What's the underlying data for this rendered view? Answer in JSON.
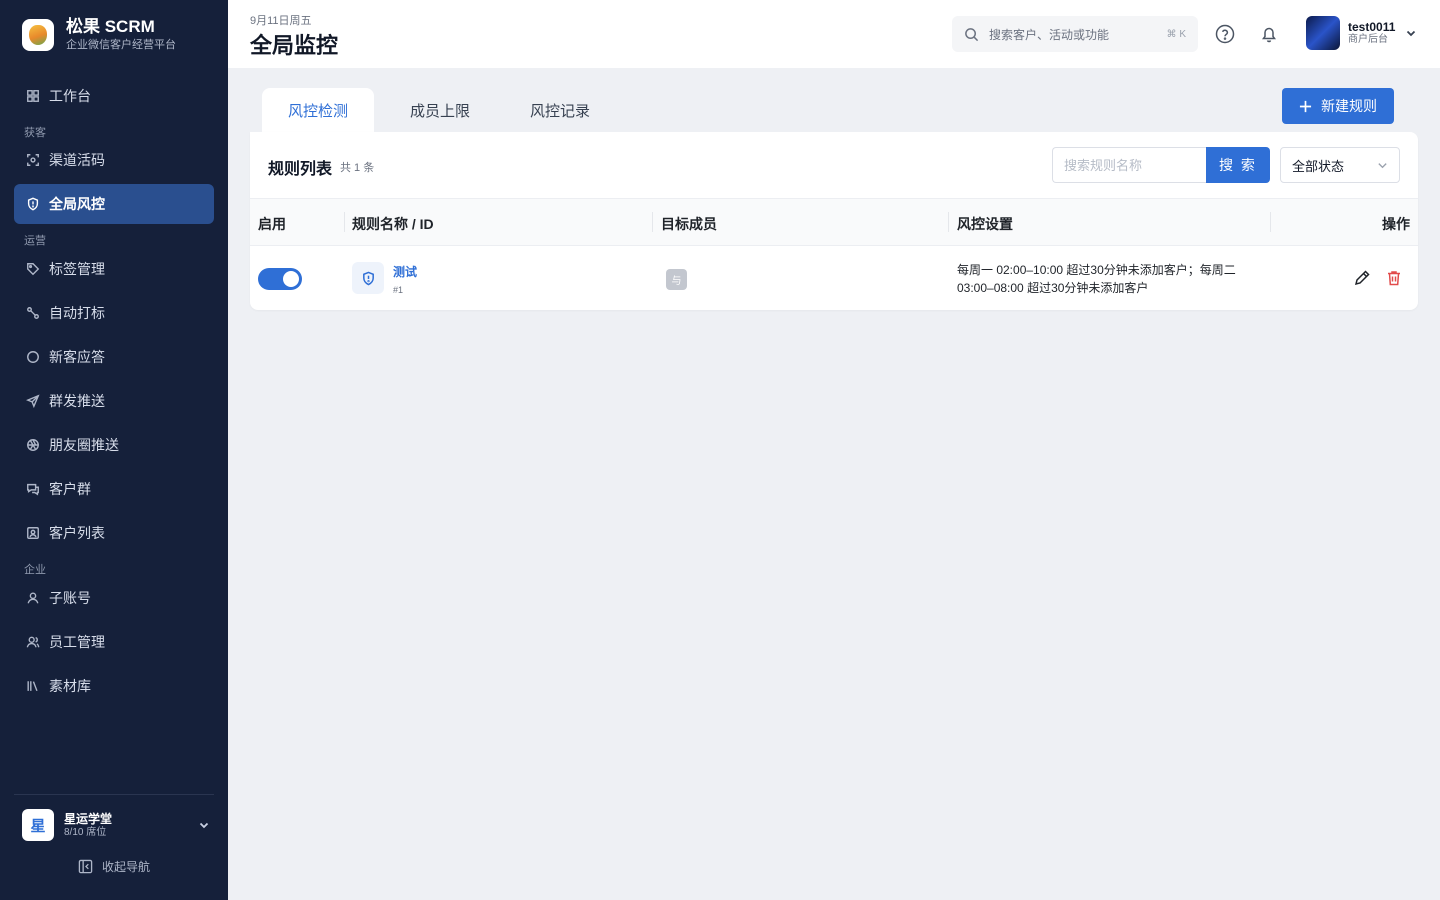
{
  "brand": {
    "name": "松果 SCRM",
    "subtitle": "企业微信客户经营平台"
  },
  "sidebar": {
    "items": [
      {
        "label": "工作台",
        "icon": "grid-icon"
      },
      {
        "group": "获客"
      },
      {
        "label": "渠道活码",
        "icon": "scan-icon"
      },
      {
        "label": "全局风控",
        "icon": "shield-icon",
        "active": true
      },
      {
        "group": "运营"
      },
      {
        "label": "标签管理",
        "icon": "tag-icon"
      },
      {
        "label": "自动打标",
        "icon": "link-icon"
      },
      {
        "label": "新客应答",
        "icon": "chat-icon"
      },
      {
        "label": "群发推送",
        "icon": "send-icon"
      },
      {
        "label": "朋友圈推送",
        "icon": "aperture-icon"
      },
      {
        "label": "客户群",
        "icon": "group-chat-icon"
      },
      {
        "label": "客户列表",
        "icon": "contact-icon"
      },
      {
        "group": "企业"
      },
      {
        "label": "子账号",
        "icon": "user-icon"
      },
      {
        "label": "员工管理",
        "icon": "users-icon"
      },
      {
        "label": "素材库",
        "icon": "library-icon"
      }
    ],
    "labels": {
      "workbench": "工作台",
      "group_acquire": "获客",
      "channel_code": "渠道活码",
      "global_risk": "全局风控",
      "group_operate": "运营",
      "tag_manage": "标签管理",
      "auto_tag": "自动打标",
      "new_reply": "新客应答",
      "mass_push": "群发推送",
      "moments_push": "朋友圈推送",
      "customer_group": "客户群",
      "customer_list": "客户列表",
      "group_company": "企业",
      "sub_account": "子账号",
      "staff_manage": "员工管理",
      "material_lib": "素材库"
    },
    "org": {
      "avatar_char": "星",
      "name": "星运学堂",
      "seats": "8/10 席位"
    },
    "collapse_label": "收起导航"
  },
  "header": {
    "date": "9月11日周五",
    "title": "全局监控",
    "search_placeholder": "搜索客户、活动或功能",
    "shortcut": "⌘ K",
    "user": {
      "name": "test0011",
      "role": "商户后台"
    }
  },
  "tabs": {
    "risk_check": "风控检测",
    "member_limit": "成员上限",
    "risk_record": "风控记录"
  },
  "new_rule_button": "新建规则",
  "panel": {
    "title": "规则列表",
    "count": "共 1 条",
    "search_placeholder": "搜索规则名称",
    "search_button": "搜 索",
    "status_filter": "全部状态"
  },
  "table": {
    "columns": {
      "enabled": "启用",
      "name_id": "规则名称 / ID",
      "target": "目标成员",
      "settings": "风控设置",
      "actions": "操作"
    },
    "rows": [
      {
        "enabled": true,
        "name": "测试",
        "id": "#1",
        "member_badge": "与",
        "settings": "每周一 02:00–10:00 超过30分钟未添加客户；每周二 03:00–08:00 超过30分钟未添加客户"
      }
    ]
  },
  "colors": {
    "accent": "#2f6fd6",
    "sidebar_bg": "#15203a",
    "active_nav": "#2a4f8f",
    "danger": "#e14b4b"
  }
}
